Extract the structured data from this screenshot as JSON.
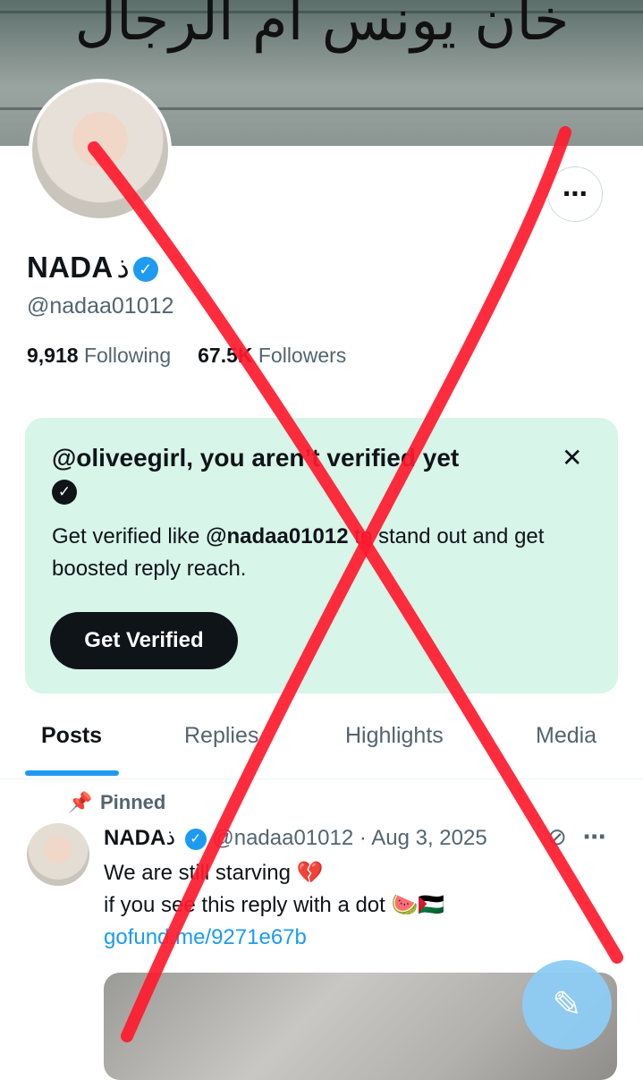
{
  "banner": {
    "text": "خان يونس أم الرجال"
  },
  "profile": {
    "name": "NADA",
    "name_glyph": "ﺫ",
    "handle": "@nadaa01012",
    "following_count": "9,918",
    "following_label": "Following",
    "followers_count": "67.5K",
    "followers_label": "Followers",
    "more_icon": "⋯"
  },
  "promo": {
    "title": "@oliveegirl, you aren’t verified yet",
    "body_prefix": "Get verified like ",
    "body_handle": "@nadaa01012",
    "body_suffix": " to stand out and get boosted reply reach.",
    "close_icon": "✕",
    "button_label": "Get Verified"
  },
  "tabs": [
    {
      "label": "Posts"
    },
    {
      "label": "Replies"
    },
    {
      "label": "Highlights"
    },
    {
      "label": "Media"
    }
  ],
  "post": {
    "pinned_label": "Pinned",
    "author": "NADA",
    "handle": "@nadaa01012",
    "separator": "·",
    "date": "Aug 3, 2025",
    "line1": "We are still starving 💔",
    "line2": "if you see this reply with a dot 🍉🇵🇸",
    "link": "gofund.me/9271e67b"
  },
  "colors": {
    "accent": "#1d9bf0",
    "promo_bg": "#d7f5e8",
    "overlay_x": "#ff1a2e"
  },
  "icons": {
    "verified": "check-badge-icon",
    "pin": "pin-icon",
    "grok": "grok-icon",
    "compose": "compose-icon"
  }
}
